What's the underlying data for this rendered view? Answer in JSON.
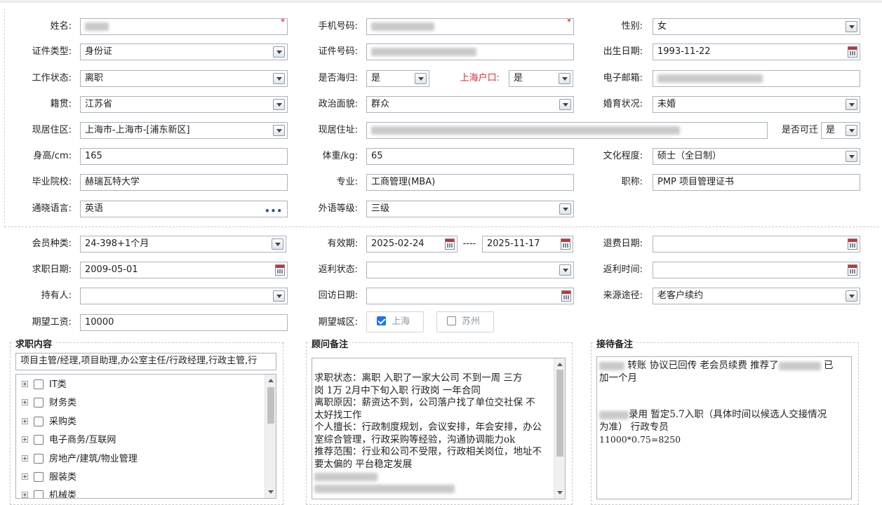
{
  "basic": {
    "name": {
      "label": "姓名:"
    },
    "phone": {
      "label": "手机号码:"
    },
    "gender": {
      "label": "性别:",
      "value": "女"
    },
    "id_type": {
      "label": "证件类型:",
      "value": "身份证"
    },
    "id_number": {
      "label": "证件号码:"
    },
    "birthday": {
      "label": "出生日期:",
      "value": "1993-11-22"
    },
    "work_status": {
      "label": "工作状态:",
      "value": "离职"
    },
    "overseas": {
      "label": "是否海归:",
      "value": "是"
    },
    "shanghai_hukou": {
      "label": "上海户口:",
      "value": "是"
    },
    "email": {
      "label": "电子邮箱:"
    },
    "native_place": {
      "label": "籍贯:",
      "value": "江苏省"
    },
    "political": {
      "label": "政治面貌:",
      "value": "群众"
    },
    "marital": {
      "label": "婚育状况:",
      "value": "未婚"
    },
    "residence_area": {
      "label": "现居住区:",
      "value": "上海市-上海市-[浦东新区]"
    },
    "residence_addr": {
      "label": "现居住址:"
    },
    "relocate": {
      "label": "是否可迁",
      "value": "是"
    },
    "height": {
      "label": "身高/cm:",
      "value": "165"
    },
    "weight": {
      "label": "体重/kg:",
      "value": "65"
    },
    "education": {
      "label": "文化程度:",
      "value": "硕士（全日制）"
    },
    "school": {
      "label": "毕业院校:",
      "value": "赫瑞瓦特大学"
    },
    "major": {
      "label": "专业:",
      "value": "工商管理(MBA)"
    },
    "title": {
      "label": "职称:",
      "value": "PMP 项目管理证书"
    },
    "languages": {
      "label": "通晓语言:",
      "value": "英语",
      "more": "•••"
    },
    "lang_level": {
      "label": "外语等级:",
      "value": "三级"
    }
  },
  "membership": {
    "member_type": {
      "label": "会员种类:",
      "value": "24-398+1个月"
    },
    "validity": {
      "label": "有效期:",
      "from": "2025-02-24",
      "sep": "----",
      "to": "2025-11-17"
    },
    "refund_date": {
      "label": "退费日期:",
      "value": ""
    },
    "job_date": {
      "label": "求职日期:",
      "value": "2009-05-01"
    },
    "rebate_status": {
      "label": "返利状态:",
      "value": ""
    },
    "rebate_time": {
      "label": "返利时间:",
      "value": ""
    },
    "holder": {
      "label": "持有人:",
      "value": ""
    },
    "visit_date": {
      "label": "回访日期:",
      "value": ""
    },
    "source": {
      "label": "来源途径:",
      "value": "老客户续约"
    },
    "salary": {
      "label": "期望工资:",
      "value": "10000"
    },
    "city": {
      "label": "期望城区:",
      "options": [
        {
          "label": "上海",
          "checked": true
        },
        {
          "label": "苏州",
          "checked": false
        }
      ]
    }
  },
  "job_panel": {
    "title": "求职内容",
    "summary": "项目主管/经理,项目助理,办公室主任/行政经理,行政主管,行",
    "tree": [
      "IT类",
      "财务类",
      "采购类",
      "电子商务/互联网",
      "房地产/建筑/物业管理",
      "服装类",
      "机械类"
    ]
  },
  "consultant_panel": {
    "title": "顾问备注",
    "lines": [
      "求职状态：离职  入职了一家大公司  不到一周 三方",
      "岗  1万 2月中下旬入职  行政岗  一年合同",
      "离职原因：薪资达不到，公司落户找了单位交社保 不",
      "太好找工作",
      "个人擅长：行政制度规划，会议安排，年会安排，办公",
      "室综合管理，行政采购等经验，沟通协调能力ok",
      "推荐范围：行业和公司不受限，行政相关岗位，地址不",
      "要太偏的  平台稳定发展"
    ]
  },
  "reception_panel": {
    "title": "接待备注",
    "line1a": "转账 协议已回传  老会员续费 推荐了",
    "line1b": "已",
    "line2": "加一个月",
    "line3a": "录用  暂定5.7入职（具体时间以候选人交接情况",
    "line4": "为准）  行政专员",
    "line5": "11000*0.75=8250"
  },
  "colors": {
    "accent": "#1a73e8",
    "required": "#e00000",
    "hukou_label": "#d32f2f"
  }
}
